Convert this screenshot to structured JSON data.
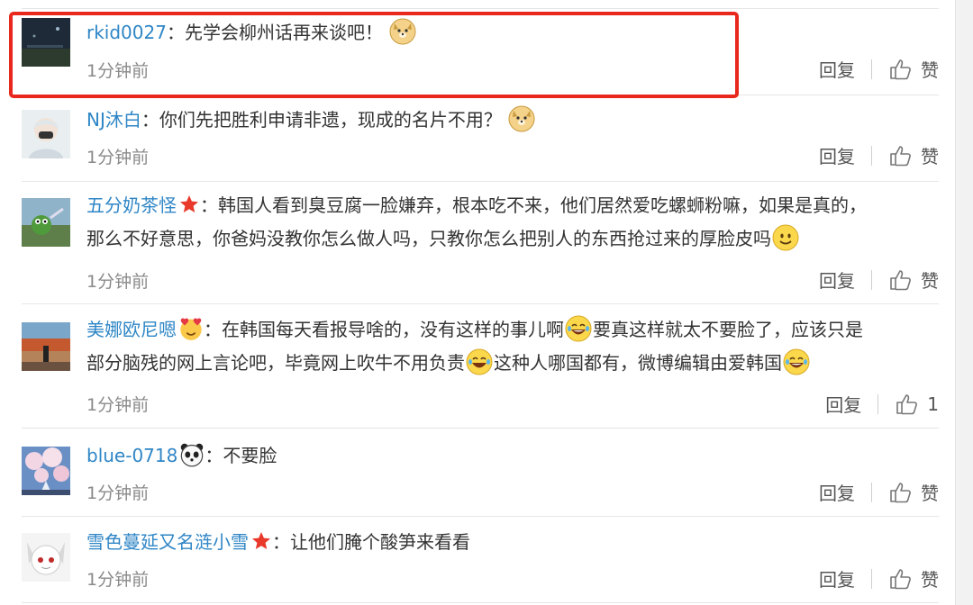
{
  "comments": [
    {
      "user": "rkid0027",
      "badge": "",
      "lines": [
        "先学会柳州话再来谈吧！"
      ],
      "emojis": [
        "doge"
      ],
      "time": "1分钟前",
      "reply": "回复",
      "like": "赞",
      "highlighted": true
    },
    {
      "user": "NJ沐白",
      "badge": "",
      "lines": [
        "你们先把胜利申请非遗，现成的名片不用？"
      ],
      "emojis": [
        "doge"
      ],
      "time": "1分钟前",
      "reply": "回复",
      "like": "赞"
    },
    {
      "user": "五分奶茶怪",
      "badge": "star",
      "lines": [
        "韩国人看到臭豆腐一脸嫌弃，根本吃不来，他们居然爱吃螺蛳粉嘛，如果是真的，",
        "那么不好意思，你爸妈没教你怎么做人吗，只教你怎么把别人的东西抢过来的厚脸皮吗"
      ],
      "emojis": [
        "smile"
      ],
      "time": "1分钟前",
      "reply": "回复",
      "like": "赞"
    },
    {
      "user": "美娜欧尼嗯",
      "badge": "heart-face",
      "lines_a": [
        "在韩国每天看报导啥的，没有这样的事儿啊",
        "要真这样就太不要脸了，应该只是"
      ],
      "lines_b": [
        "部分脑残的网上言论吧，毕竟网上吹牛不用负责",
        "这种人哪国都有，微博编辑由爱韩国"
      ],
      "time": "1分钟前",
      "reply": "回复",
      "like": "1"
    },
    {
      "user": "blue-0718",
      "badge": "panda",
      "lines": [
        "不要脸"
      ],
      "time": "1分钟前",
      "reply": "回复",
      "like": "赞"
    },
    {
      "user": "雪色蔓延又名涟小雪",
      "badge": "star",
      "lines": [
        "让他们腌个酸笋来看看"
      ],
      "time": "1分钟前",
      "reply": "回复",
      "like": "赞"
    }
  ],
  "colors": {
    "username": "#2f86c6",
    "highlight_border": "#e8271d",
    "muted": "#8a8a8a"
  }
}
